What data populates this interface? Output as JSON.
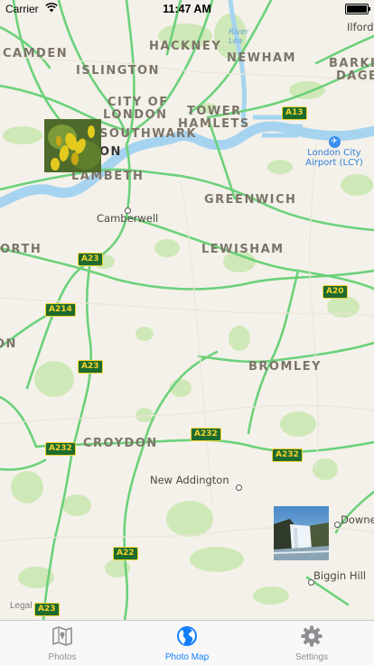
{
  "status_bar": {
    "carrier": "Carrier",
    "time": "11:47 AM"
  },
  "map": {
    "places": {
      "camden": "CAMDEN",
      "islington": "ISLINGTON",
      "hackney": "HACKNEY",
      "newham": "NEWHAM",
      "barking": "BARKING",
      "dagenham": "DAGE",
      "city_of_london_1": "CITY OF",
      "city_of_london_2": "LONDON",
      "tower_hamlets_1": "TOWER",
      "tower_hamlets_2": "HAMLETS",
      "southwark": "SOUTHWARK",
      "london": "ON",
      "lambeth": "LAMBETH",
      "greenwich": "GREENWICH",
      "lewisham": "LEWISHAM",
      "wandsworth": "ORTH",
      "bromley": "BROMLEY",
      "croydon": "CROYDON",
      "sutton": "ON"
    },
    "towns": {
      "ilford": "Ilford",
      "camberwell": "Camberwell",
      "new_addington": "New Addington",
      "downe": "Downe",
      "biggin_hill": "Biggin Hill"
    },
    "river_label": [
      "River",
      "Lea"
    ],
    "airport": {
      "line1": "London City",
      "line2": "Airport (LCY)"
    },
    "roads": [
      "A13",
      "A23",
      "A214",
      "A23",
      "A20",
      "A232",
      "A232",
      "A232",
      "A22",
      "A23"
    ],
    "legal": "Legal"
  },
  "tabs": [
    {
      "label": "Photos",
      "icon": "map-book-icon",
      "active": false
    },
    {
      "label": "Photo Map",
      "icon": "globe-icon",
      "active": true
    },
    {
      "label": "Settings",
      "icon": "gear-icon",
      "active": false
    }
  ],
  "colors": {
    "accent": "#147efb",
    "road": "#6cd17a",
    "water": "#9fd1ef",
    "park": "#c8e6b0"
  }
}
